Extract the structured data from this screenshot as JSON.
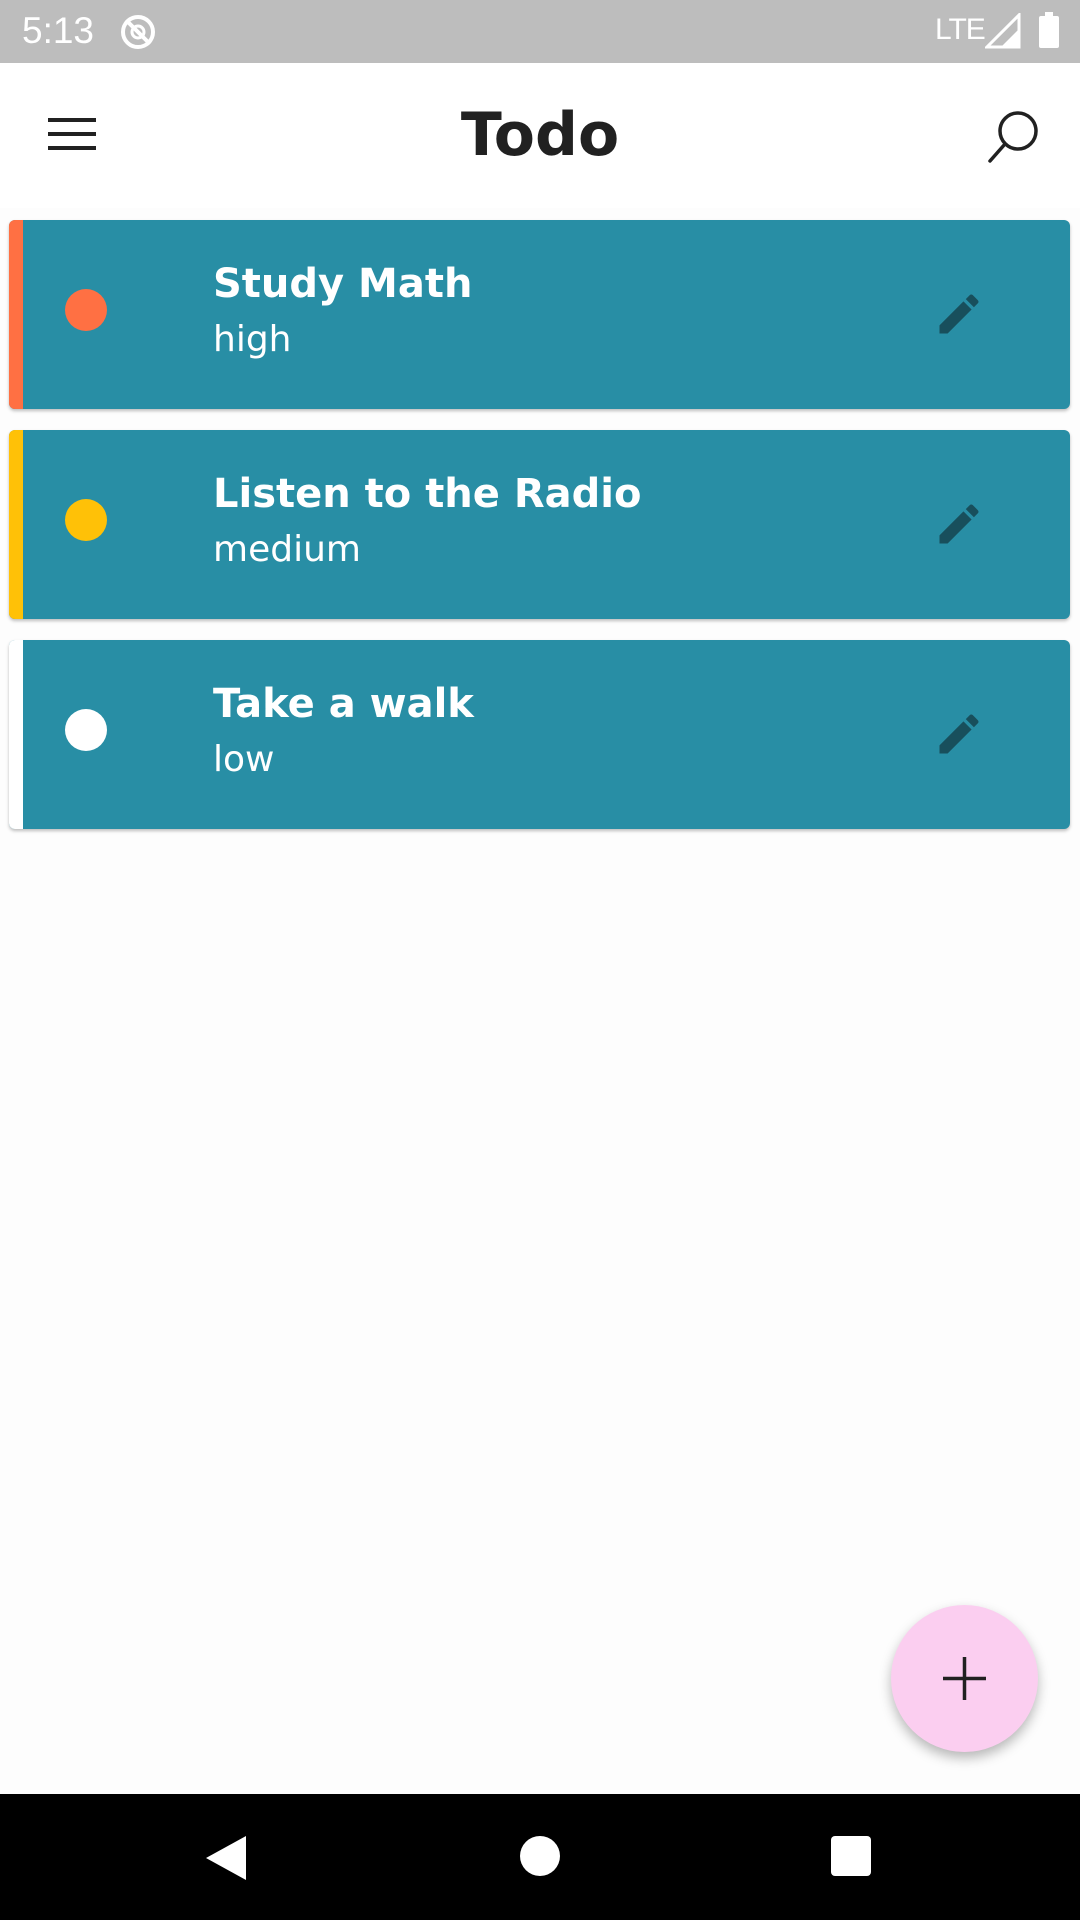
{
  "status_bar": {
    "time": "5:13",
    "network": "LTE",
    "icons": [
      "sync-disabled-icon",
      "signal-icon",
      "battery-icon"
    ]
  },
  "app_bar": {
    "title": "Todo",
    "menu_icon": "menu-icon",
    "search_icon": "search-icon"
  },
  "tasks": [
    {
      "title": "Study Math",
      "priority": "high",
      "color": "#ff7043"
    },
    {
      "title": "Listen to the Radio",
      "priority": "medium",
      "color": "#ffc107"
    },
    {
      "title": "Take a walk",
      "priority": "low",
      "color": "#ffffff"
    }
  ],
  "card_color": "#288ea5",
  "edit_icon": "edit-pencil-icon",
  "fab": {
    "icon": "plus-icon",
    "color": "#fbcef0"
  },
  "nav_bar": {
    "icons": [
      "back-icon",
      "home-icon",
      "recents-icon"
    ]
  }
}
